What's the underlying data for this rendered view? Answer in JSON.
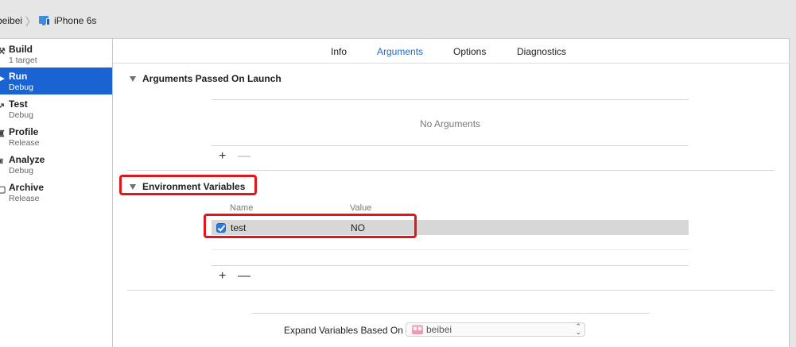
{
  "breadcrumb": {
    "scheme": "beibei",
    "separator": "〉",
    "device": "iPhone 6s"
  },
  "sidebar": {
    "items": [
      {
        "title": "Build",
        "subtitle": "1 target",
        "icon": "hammer-icon",
        "selected": false
      },
      {
        "title": "Run",
        "subtitle": "Debug",
        "icon": "play-icon",
        "selected": true
      },
      {
        "title": "Test",
        "subtitle": "Debug",
        "icon": "wrench-icon",
        "selected": false
      },
      {
        "title": "Profile",
        "subtitle": "Release",
        "icon": "instruments-icon",
        "selected": false
      },
      {
        "title": "Analyze",
        "subtitle": "Debug",
        "icon": "analyze-icon",
        "selected": false
      },
      {
        "title": "Archive",
        "subtitle": "Release",
        "icon": "archive-icon",
        "selected": false
      }
    ]
  },
  "tabs": [
    {
      "label": "Info",
      "active": false
    },
    {
      "label": "Arguments",
      "active": true
    },
    {
      "label": "Options",
      "active": false
    },
    {
      "label": "Diagnostics",
      "active": false
    }
  ],
  "arguments": {
    "title": "Arguments Passed On Launch",
    "empty_text": "No Arguments",
    "add": "+",
    "remove": "—"
  },
  "environment": {
    "title": "Environment Variables",
    "col_name": "Name",
    "col_value": "Value",
    "rows": [
      {
        "enabled": true,
        "name": "test",
        "value": "NO"
      }
    ],
    "add": "+",
    "remove": "—"
  },
  "expand": {
    "label": "Expand Variables Based On",
    "selected": "beibei"
  },
  "colors": {
    "selection": "#1964d2",
    "active_tab": "#1a6ad6",
    "highlight_box": "#e0161c"
  }
}
